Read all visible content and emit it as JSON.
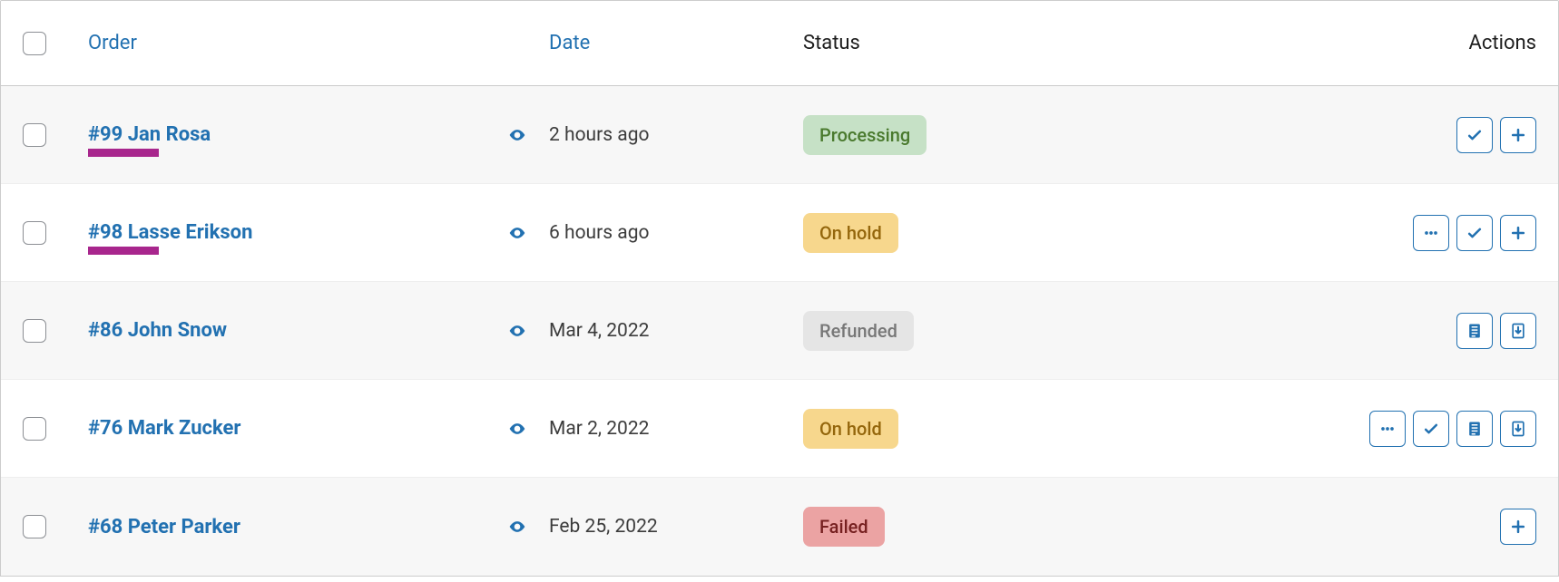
{
  "columns": {
    "order": "Order",
    "date": "Date",
    "status": "Status",
    "actions": "Actions"
  },
  "status_labels": {
    "processing": "Processing",
    "on-hold": "On hold",
    "refunded": "Refunded",
    "failed": "Failed"
  },
  "rows": [
    {
      "order": "#99 Jan Rosa",
      "underline": true,
      "date": "2 hours ago",
      "status": "processing",
      "actions": [
        "check",
        "plus"
      ]
    },
    {
      "order": "#98 Lasse Erikson",
      "underline": true,
      "date": "6 hours ago",
      "status": "on-hold",
      "actions": [
        "dots",
        "check",
        "plus"
      ]
    },
    {
      "order": "#86 John Snow",
      "underline": false,
      "date": "Mar 4, 2022",
      "status": "refunded",
      "actions": [
        "invoice",
        "download"
      ]
    },
    {
      "order": "#76 Mark Zucker",
      "underline": false,
      "date": "Mar 2, 2022",
      "status": "on-hold",
      "actions": [
        "dots",
        "check",
        "invoice",
        "download"
      ]
    },
    {
      "order": "#68 Peter Parker",
      "underline": false,
      "date": "Feb 25, 2022",
      "status": "failed",
      "actions": [
        "plus"
      ]
    }
  ]
}
